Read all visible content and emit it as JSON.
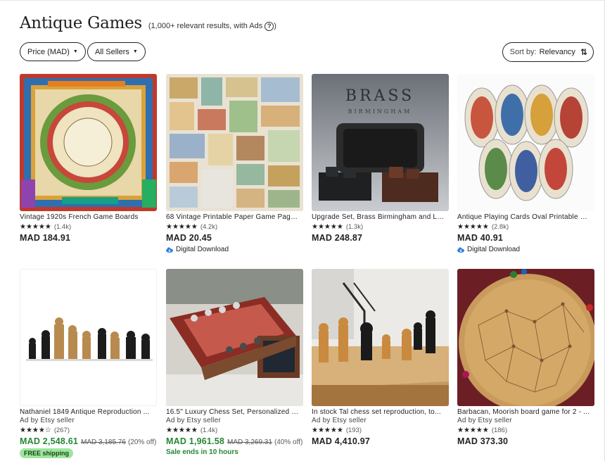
{
  "header": {
    "title": "Antique Games",
    "subtitle": "(1,000+ relevant results, with Ads",
    "subtitle_close": ")",
    "help_glyph": "?"
  },
  "filters": {
    "price_label": "Price (MAD)",
    "sellers_label": "All Sellers",
    "caret_glyph": "▼",
    "sort_label": "Sort by:",
    "sort_value": "Relevancy",
    "sort_glyph": "⇅"
  },
  "listings": [
    {
      "title": "Vintage 1920s French Game Boards",
      "stars": "★★★★★",
      "reviews": "(1.4k)",
      "price": "MAD 184.91"
    },
    {
      "title": "68 Vintage Printable Paper Game Pages...",
      "stars": "★★★★★",
      "reviews": "(4.2k)",
      "price": "MAD 20.45",
      "digital": "Digital Download"
    },
    {
      "title": "Upgrade Set, Brass Birmingham and La...",
      "stars": "★★★★★",
      "reviews": "(1.3k)",
      "price": "MAD 248.87",
      "image_text_1": "BRASS",
      "image_text_2": "BIRMINGHAM"
    },
    {
      "title": "Antique Playing Cards Oval Printable D...",
      "stars": "★★★★★",
      "reviews": "(2.8k)",
      "price": "MAD 40.91",
      "digital": "Digital Download"
    },
    {
      "title": "Nathaniel 1849 Antique Reproduction ...",
      "ad": "Ad by Etsy seller",
      "stars": "★★★★☆",
      "reviews": "(267)",
      "price": "MAD 2,548.61",
      "orig_price": "MAD 3,185.76",
      "discount": "(20% off)",
      "badge": "FREE shipping"
    },
    {
      "title": "16.5\" Luxury Chess Set, Personalized W...",
      "ad": "Ad by Etsy seller",
      "stars": "★★★★★",
      "reviews": "(1.4k)",
      "price": "MAD 1,961.58",
      "orig_price": "MAD 3,269.31",
      "discount": "(40% off)",
      "sale_ends": "Sale ends in 10 hours"
    },
    {
      "title": "In stock Tal chess set reproduction, to...",
      "ad": "Ad by Etsy seller",
      "stars": "★★★★★",
      "reviews": "(193)",
      "price": "MAD 4,410.97"
    },
    {
      "title": "Barbacan, Moorish board game for 2 - ...",
      "ad": "Ad by Etsy seller",
      "stars": "★★★★★",
      "reviews": "(186)",
      "price": "MAD 373.30"
    }
  ],
  "colors": {
    "sale_green": "#258635",
    "badge_green": "#9ce79b",
    "digital_blue": "#2d7fe0"
  }
}
